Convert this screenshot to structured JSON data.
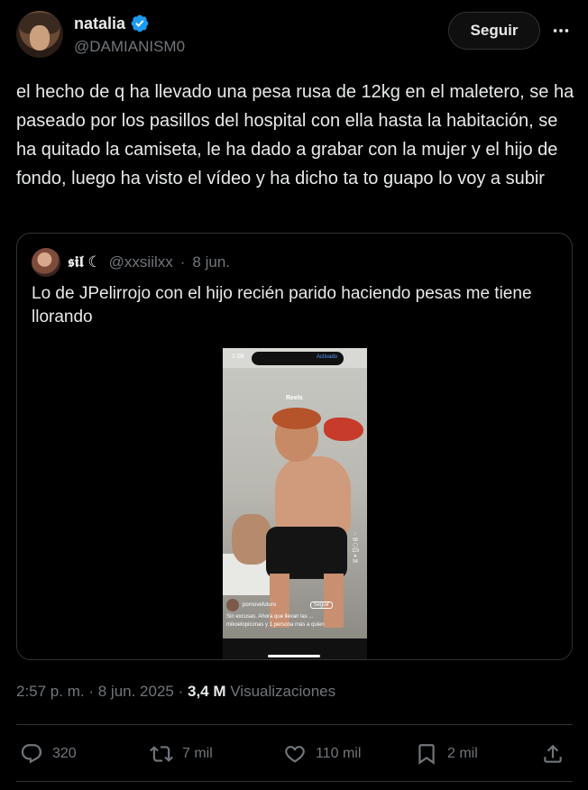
{
  "author": {
    "name": "natalia",
    "handle": "@DAMIANISM0",
    "verified": true
  },
  "follow_label": "Seguir",
  "tweet_text": "el hecho de q ha llevado una pesa rusa de 12kg en el maletero, se ha paseado por los pasillos del hospital con ella hasta la habitación, se ha quitado la camiseta, le ha dado a grabar con la mujer y el hijo de fondo, luego ha visto el vídeo y ha dicho ta to guapo lo voy a subir",
  "quote": {
    "name": "𝖘𝖎𝖑 ☾",
    "handle": "@xxsiilxx",
    "date": "8 jun.",
    "text": "Lo de JPelirrojo con el hijo recién parido haciendo pesas me tiene llorando",
    "media": {
      "status_time": "1:08",
      "island_label": "Activado",
      "screen_title": "Reels",
      "reel_user": "pornovefuturo",
      "reel_follow": "Seguir",
      "reel_caption": "Sin excusas. Ahora que llevan las ...",
      "reel_likes_line": "mikoelopiconas y 1 persona más a quien",
      "counts": [
        "58",
        "119",
        "54"
      ]
    }
  },
  "meta": {
    "time": "2:57 p. m.",
    "date": "8 jun. 2025",
    "views_count": "3,4 M",
    "views_label": "Visualizaciones"
  },
  "actions": {
    "replies": "320",
    "reposts": "7 mil",
    "likes": "110 mil",
    "bookmarks": "2 mil"
  },
  "colors": {
    "background": "#000000",
    "text": "#e7e9ea",
    "secondary": "#71767b",
    "verified": "#1d9bf0",
    "border": "#2f3336"
  }
}
